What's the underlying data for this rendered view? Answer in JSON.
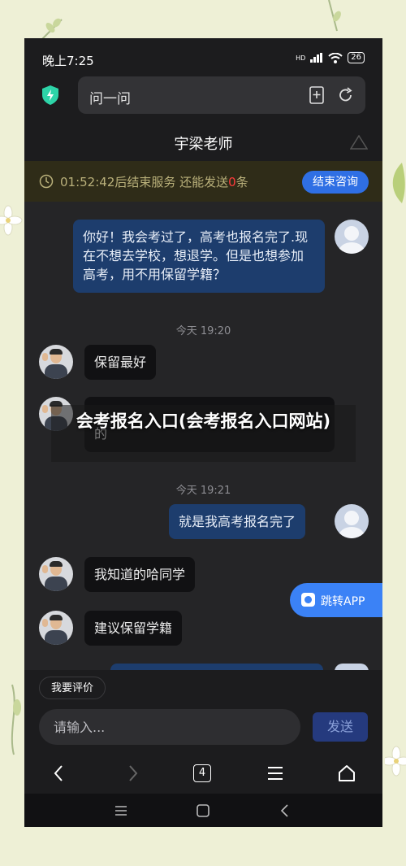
{
  "status_bar": {
    "time": "晚上7:25",
    "network": "HD",
    "battery": "26"
  },
  "search": {
    "text": "问一问"
  },
  "chat_header": {
    "title": "宇梁老师"
  },
  "notice": {
    "time_left": "01:52:42",
    "text_prefix": "后结束服务  还能发送",
    "remaining": "0",
    "text_suffix": "条",
    "end_button": "结束咨询"
  },
  "messages": [
    {
      "from": "user",
      "text": "你好！我会考过了，高考也报名完了.现在不想去学校，想退学。但是也想参加高考，用不用保留学籍？"
    },
    {
      "timestamp": "今天 19:20"
    },
    {
      "from": "teacher",
      "text": "保留最好"
    },
    {
      "from": "teacher",
      "text": "的"
    },
    {
      "timestamp": "今天 19:21"
    },
    {
      "from": "user",
      "text": "就是我高考报名完了"
    },
    {
      "from": "teacher",
      "text": "我知道的哈同学"
    },
    {
      "from": "teacher",
      "text": "建议保留学籍"
    }
  ],
  "overlay_title": "会考报名入口(会考报名入口网站)",
  "jump_app": {
    "label": "跳转APP"
  },
  "rate_button": "我要评价",
  "input": {
    "placeholder": "请输入..."
  },
  "send_button": "发送",
  "browser_nav": {
    "tabs_count": "4"
  },
  "colors": {
    "accent": "#2f6fe4",
    "user_bubble": "#1d3d6d",
    "warning": "#ff3b3b"
  }
}
